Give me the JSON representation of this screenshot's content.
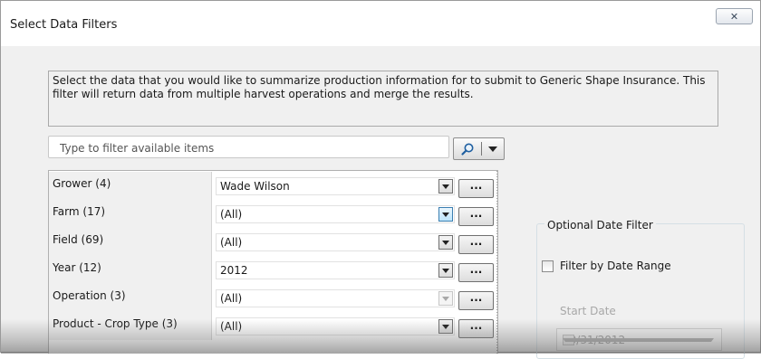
{
  "window": {
    "title": "Select Data Filters",
    "close_glyph": "✕"
  },
  "description": "Select the data that you would like to summarize production information for to submit to Generic Shape Insurance. This filter will return data from multiple harvest operations and merge the results.",
  "search": {
    "placeholder": "Type to filter available items",
    "button_icon": "search-icon",
    "dropdown_icon": "chevron-down-icon"
  },
  "filters": [
    {
      "label": "Grower (4)",
      "value": "Wade Wilson",
      "arrow_state": "normal"
    },
    {
      "label": "Farm (17)",
      "value": "(All)",
      "arrow_state": "hot"
    },
    {
      "label": "Field (69)",
      "value": "(All)",
      "arrow_state": "normal"
    },
    {
      "label": "Year (12)",
      "value": "2012",
      "arrow_state": "normal"
    },
    {
      "label": "Operation (3)",
      "value": "(All)",
      "arrow_state": "disabled"
    },
    {
      "label": "Product - Crop Type (3)",
      "value": "(All)",
      "arrow_state": "normal"
    }
  ],
  "ellipsis_label": "...",
  "date_filter": {
    "group_title": "Optional Date Filter",
    "checkbox_label": "Filter by Date Range",
    "checked": false,
    "start_label": "Start Date",
    "start_value": "10/31/2012"
  },
  "colors": {
    "window_bg": "#f0f0f0",
    "titlebar_bg": "#ffffff",
    "hot_arrow": "#bde6fd"
  }
}
